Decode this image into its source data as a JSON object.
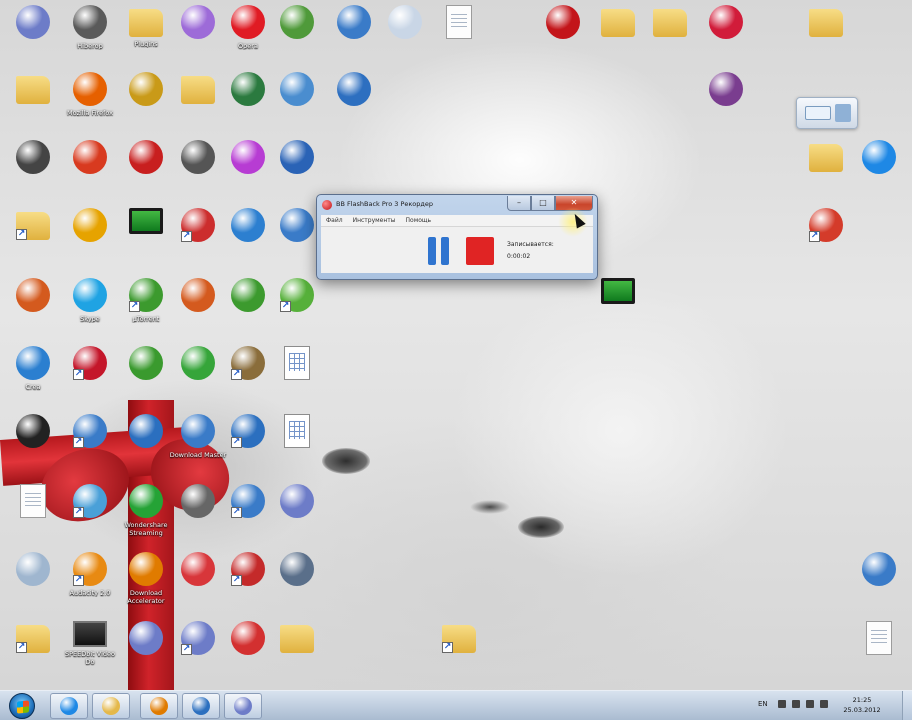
{
  "desktop_icons": [
    {
      "label": "",
      "type": "clock-icon",
      "color": "#6d7cc8"
    },
    {
      "label": "Hiberop",
      "type": "film-icon",
      "color": "#5a5a5a"
    },
    {
      "label": "Plugins",
      "type": "folder-icon",
      "color": "#e4b84a"
    },
    {
      "label": "",
      "type": "disc-icon",
      "color": "#9d6bd8"
    },
    {
      "label": "Opera",
      "type": "opera-icon",
      "color": "#e01b24"
    },
    {
      "label": "",
      "type": "map-icon",
      "color": "#4f9a3a"
    },
    {
      "label": "",
      "type": "network-icon",
      "color": "#3a7bc8"
    },
    {
      "label": "",
      "type": "window-icon",
      "color": "#c9d6e6"
    },
    {
      "label": "",
      "type": "document-icon",
      "color": "#ffffff"
    },
    {
      "label": "",
      "type": "flash-icon",
      "color": "#c3151a"
    },
    {
      "label": "",
      "type": "folder-icon",
      "color": "#e4b84a"
    },
    {
      "label": "",
      "type": "folder-icon",
      "color": "#e4b84a"
    },
    {
      "label": "",
      "type": "heart-icon",
      "color": "#d11c3a"
    },
    {
      "label": "",
      "type": "folder-icon",
      "color": "#e4b84a"
    },
    {
      "label": "",
      "type": "folder-icon",
      "color": "#e4b84a"
    },
    {
      "label": "Mozilla Firefox",
      "type": "firefox-icon",
      "color": "#e66000"
    },
    {
      "label": "",
      "type": "gold-icon",
      "color": "#c99a18"
    },
    {
      "label": "",
      "type": "folder-icon",
      "color": "#e4b84a"
    },
    {
      "label": "",
      "type": "film-icon",
      "color": "#2b7a3f"
    },
    {
      "label": "",
      "type": "globe-icon",
      "color": "#4a8dcf"
    },
    {
      "label": "",
      "type": "uninstall-icon",
      "color": "#2d6fc0"
    },
    {
      "label": "",
      "type": "archive-icon",
      "color": "#7a3d8f"
    },
    {
      "label": "",
      "type": "reel-icon",
      "color": "#444444"
    },
    {
      "label": "",
      "type": "ccleaner-icon",
      "color": "#d83a1f"
    },
    {
      "label": "",
      "type": "shield-icon",
      "color": "#c81f1f"
    },
    {
      "label": "",
      "type": "mic-icon",
      "color": "#555555"
    },
    {
      "label": "",
      "type": "sphere-icon",
      "color": "#b73cd3"
    },
    {
      "label": "",
      "type": "ico-icon",
      "color": "#2a63b6"
    },
    {
      "label": "",
      "type": "folder-icon",
      "color": "#e4b84a"
    },
    {
      "label": "",
      "type": "ie-icon",
      "color": "#1e88e5"
    },
    {
      "label": "",
      "type": "folder-icon",
      "color": "#e4b84a"
    },
    {
      "label": "",
      "type": "web-icon",
      "color": "#e6a300"
    },
    {
      "label": "",
      "type": "monitor-icon",
      "color": "#1f9a2e"
    },
    {
      "label": "",
      "type": "chart-icon",
      "color": "#cc2d2d"
    },
    {
      "label": "",
      "type": "earth-icon",
      "color": "#2c7fd0"
    },
    {
      "label": "",
      "type": "photo-icon",
      "color": "#3a7bc8"
    },
    {
      "label": "",
      "type": "person-icon",
      "color": "#d43b2a"
    },
    {
      "label": "",
      "type": "e-icon",
      "color": "#d45a1e"
    },
    {
      "label": "Skype",
      "type": "skype-icon",
      "color": "#1fa3e3"
    },
    {
      "label": "µTorrent",
      "type": "utorrent-icon",
      "color": "#3c9a2e"
    },
    {
      "label": "",
      "type": "e-icon",
      "color": "#d45a1e"
    },
    {
      "label": "",
      "type": "utorrent-icon",
      "color": "#3c9a2e"
    },
    {
      "label": "",
      "type": "puzzle-icon",
      "color": "#56b03a"
    },
    {
      "label": "",
      "type": "monitor-icon",
      "color": "#1f9a2e"
    },
    {
      "label": "Crea",
      "type": "globe-icon",
      "color": "#2b7fd0"
    },
    {
      "label": "",
      "type": "check-icon",
      "color": "#c4162a"
    },
    {
      "label": "",
      "type": "g-icon",
      "color": "#3a9a2e"
    },
    {
      "label": "",
      "type": "arrows-icon",
      "color": "#36a53a"
    },
    {
      "label": "",
      "type": "boat-icon",
      "color": "#8a6d3b"
    },
    {
      "label": "",
      "type": "sheet-icon",
      "color": "#3a67b3"
    },
    {
      "label": "",
      "type": "sd-icon",
      "color": "#222222"
    },
    {
      "label": "",
      "type": "pc-icon",
      "color": "#3a7bc8"
    },
    {
      "label": "",
      "type": "media-icon",
      "color": "#2b6fbf"
    },
    {
      "label": "Download Master",
      "type": "download-icon",
      "color": "#3a7bc8"
    },
    {
      "label": "",
      "type": "tools-icon",
      "color": "#2b6fbf"
    },
    {
      "label": "",
      "type": "sheet-icon",
      "color": "#3a67b3"
    },
    {
      "label": "",
      "type": "document-icon",
      "color": "#ffffff"
    },
    {
      "label": "",
      "type": "audio-icon",
      "color": "#4aa0d8"
    },
    {
      "label": "Wondershare Streaming",
      "type": "headphones-icon",
      "color": "#25a336"
    },
    {
      "label": "",
      "type": "camera-icon",
      "color": "#666666"
    },
    {
      "label": "",
      "type": "yandex-icon",
      "color": "#3a7bc8"
    },
    {
      "label": "",
      "type": "clock-icon",
      "color": "#6d7cc8"
    },
    {
      "label": "",
      "type": "recycle-bin-icon",
      "color": "#9fb6cf"
    },
    {
      "label": "Audacity 2.0",
      "type": "audacity-icon",
      "color": "#e88a12"
    },
    {
      "label": "Download Accelerator",
      "type": "dap-icon",
      "color": "#e07b00"
    },
    {
      "label": "",
      "type": "upload-icon",
      "color": "#d8363a"
    },
    {
      "label": "",
      "type": "doc-pdf-icon",
      "color": "#c42a2a"
    },
    {
      "label": "",
      "type": "drive-icon",
      "color": "#5a6f8a"
    },
    {
      "label": "",
      "type": "computer-icon",
      "color": "#3a7bc8"
    },
    {
      "label": "",
      "type": "folder-icon",
      "color": "#e4b84a"
    },
    {
      "label": "SPEEDbit Video Do",
      "type": "download-icon",
      "color": "#222222"
    },
    {
      "label": "",
      "type": "clock-icon",
      "color": "#6d7cc8"
    },
    {
      "label": "",
      "type": "clock-icon",
      "color": "#6d7cc8"
    },
    {
      "label": "",
      "type": "swf-icon",
      "color": "#d33030"
    },
    {
      "label": "",
      "type": "folder-icon",
      "color": "#e4b84a"
    },
    {
      "label": "",
      "type": "folder-icon",
      "color": "#e4b84a"
    },
    {
      "label": "",
      "type": "document-icon",
      "color": "#ffffff"
    }
  ],
  "gadget": {
    "name": "gadget-icon"
  },
  "recorder": {
    "title": "BB FlashBack Pro 3 Рекордер",
    "menu": [
      "Файл",
      "Инструменты",
      "Помощь"
    ],
    "status": "Записывается:",
    "timer": "0:00:02",
    "close_glyph": "✕",
    "min_glyph": "–",
    "max_glyph": "□",
    "colors": {
      "pause": "#2f74cf",
      "stop": "#e02424"
    }
  },
  "taskbar": {
    "apps": [
      "ie-icon",
      "explorer-icon",
      "cardbox-icon",
      "media-icon",
      "clock-icon"
    ],
    "lang": "EN",
    "time": "21:25",
    "date": "25.03.2012"
  }
}
